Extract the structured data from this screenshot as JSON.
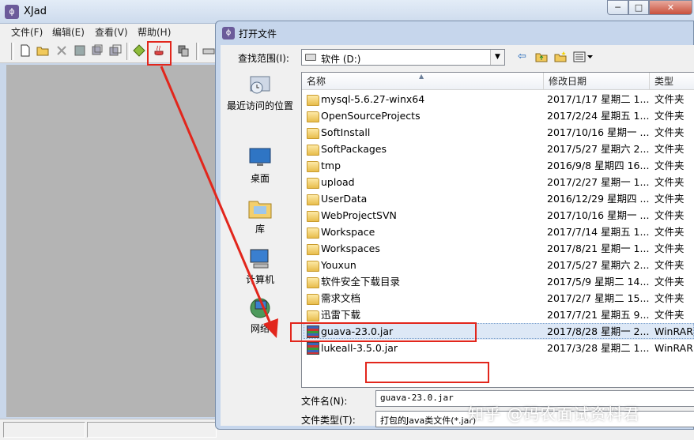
{
  "main_window": {
    "title": "XJad",
    "menu": [
      "文件(F)",
      "编辑(E)",
      "查看(V)",
      "帮助(H)"
    ],
    "window_controls": {
      "minimize": "─",
      "maximize": "□",
      "close": "✕"
    }
  },
  "dialog": {
    "title": "打开文件",
    "look_in_label": "查找范围(I):",
    "look_in_value": "软件 (D:)",
    "places": [
      {
        "label": "最近访问的位置",
        "icon": "recent-places-icon"
      },
      {
        "label": "桌面",
        "icon": "desktop-icon"
      },
      {
        "label": "库",
        "icon": "library-icon"
      },
      {
        "label": "计算机",
        "icon": "computer-icon"
      },
      {
        "label": "网络",
        "icon": "network-icon"
      }
    ],
    "columns": {
      "name": "名称",
      "date": "修改日期",
      "type": "类型"
    },
    "files": [
      {
        "name": "mysql-5.6.27-winx64",
        "date": "2017/1/17 星期二 1...",
        "type": "文件夹",
        "kind": "folder"
      },
      {
        "name": "OpenSourceProjects",
        "date": "2017/2/24 星期五 1...",
        "type": "文件夹",
        "kind": "folder"
      },
      {
        "name": "SoftInstall",
        "date": "2017/10/16 星期一 ...",
        "type": "文件夹",
        "kind": "folder"
      },
      {
        "name": "SoftPackages",
        "date": "2017/5/27 星期六 2...",
        "type": "文件夹",
        "kind": "folder"
      },
      {
        "name": "tmp",
        "date": "2016/9/8 星期四 16...",
        "type": "文件夹",
        "kind": "folder"
      },
      {
        "name": "upload",
        "date": "2017/2/27 星期一 1...",
        "type": "文件夹",
        "kind": "folder"
      },
      {
        "name": "UserData",
        "date": "2016/12/29 星期四 ...",
        "type": "文件夹",
        "kind": "folder"
      },
      {
        "name": "WebProjectSVN",
        "date": "2017/10/16 星期一 ...",
        "type": "文件夹",
        "kind": "folder"
      },
      {
        "name": "Workspace",
        "date": "2017/7/14 星期五 1...",
        "type": "文件夹",
        "kind": "folder"
      },
      {
        "name": "Workspaces",
        "date": "2017/8/21 星期一 1...",
        "type": "文件夹",
        "kind": "folder"
      },
      {
        "name": "Youxun",
        "date": "2017/5/27 星期六 2...",
        "type": "文件夹",
        "kind": "folder"
      },
      {
        "name": "软件安全下载目录",
        "date": "2017/5/9 星期二 14...",
        "type": "文件夹",
        "kind": "folder"
      },
      {
        "name": "需求文档",
        "date": "2017/2/7 星期二 15...",
        "type": "文件夹",
        "kind": "folder"
      },
      {
        "name": "迅雷下载",
        "date": "2017/7/21 星期五 9...",
        "type": "文件夹",
        "kind": "folder"
      },
      {
        "name": "guava-23.0.jar",
        "date": "2017/8/28 星期一 2...",
        "type": "WinRAR 压",
        "kind": "jar",
        "selected": true
      },
      {
        "name": "lukeall-3.5.0.jar",
        "date": "2017/3/28 星期二 1...",
        "type": "WinRAR 压",
        "kind": "jar"
      }
    ],
    "file_name_label": "文件名(N):",
    "file_name_value": "guava-23.0.jar",
    "file_type_label": "文件类型(T):",
    "file_type_value": "打包的Java类文件(*.jar)"
  },
  "watermark": "知乎 @码农面试资料君",
  "colors": {
    "annotation_red": "#e2261c",
    "selection": "#dde8f6"
  }
}
